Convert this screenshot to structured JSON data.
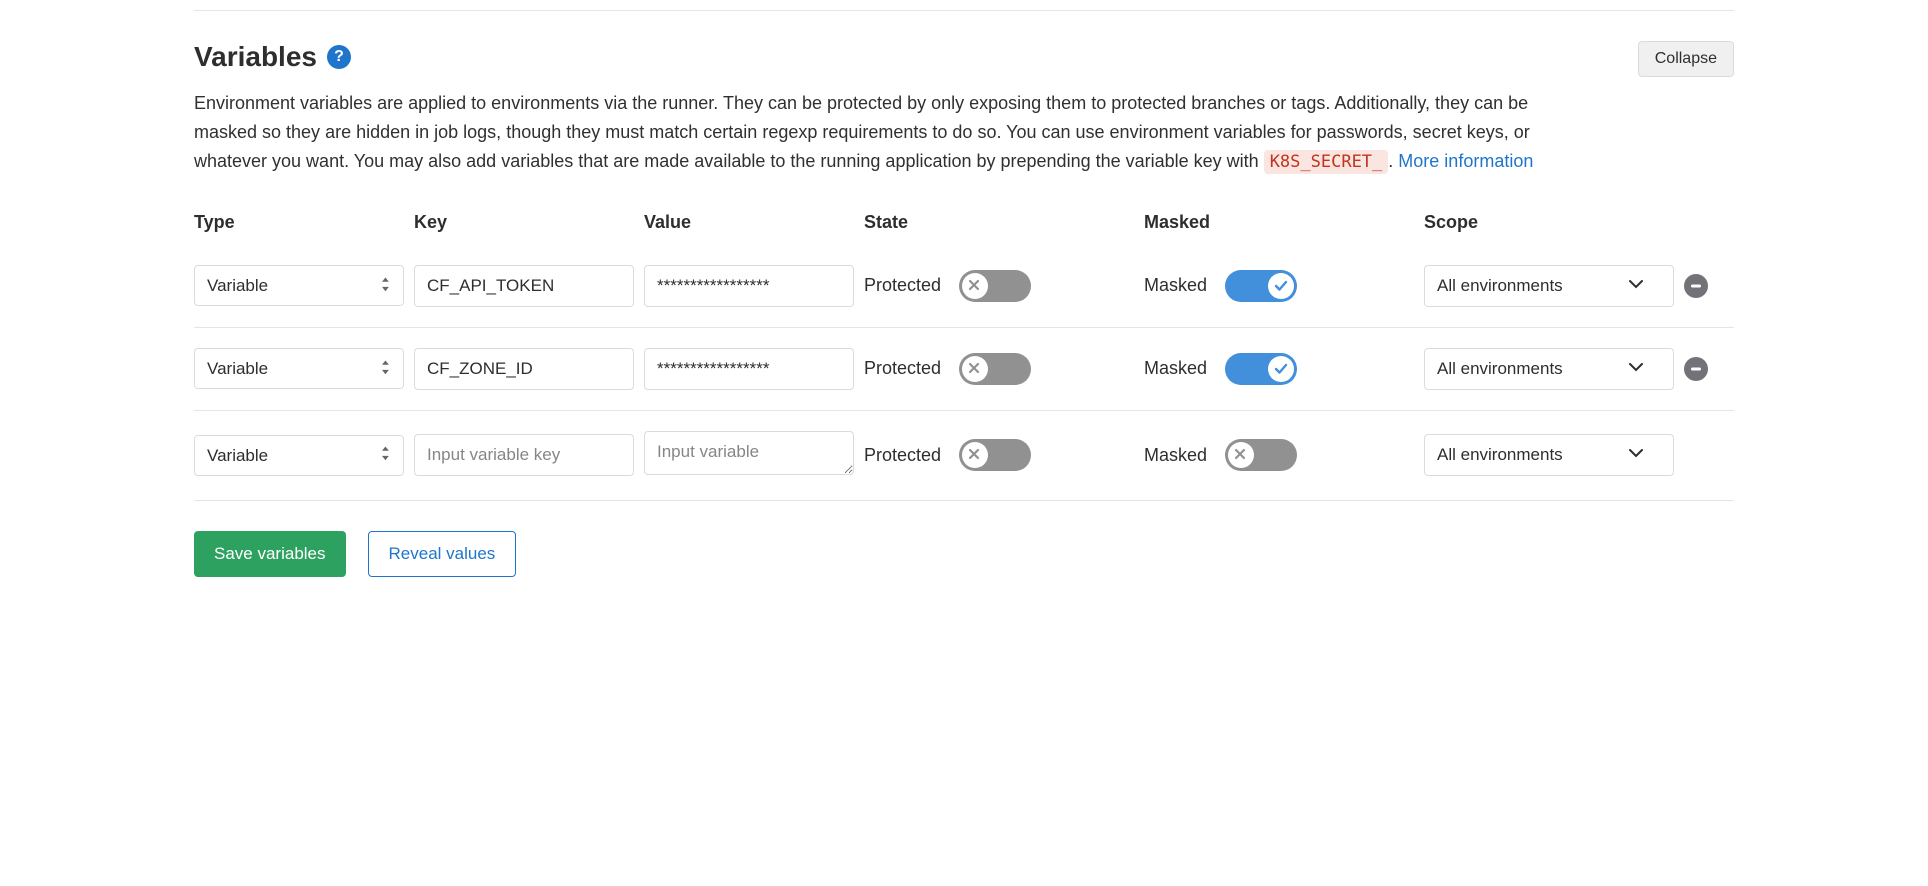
{
  "header": {
    "title": "Variables",
    "collapse_label": "Collapse"
  },
  "description": {
    "text_before_code": "Environment variables are applied to environments via the runner. They can be protected by only exposing them to protected branches or tags. Additionally, they can be masked so they are hidden in job logs, though they must match certain regexp requirements to do so. You can use environment variables for passwords, secret keys, or whatever you want. You may also add variables that are made available to the running application by prepending the variable key with ",
    "code_snippet": "K8S_SECRET_",
    "period": ". ",
    "link_text": "More information"
  },
  "columns": {
    "type": "Type",
    "key": "Key",
    "value": "Value",
    "state": "State",
    "masked": "Masked",
    "scope": "Scope"
  },
  "labels": {
    "protected": "Protected",
    "masked": "Masked"
  },
  "type_option": "Variable",
  "scope_option": "All environments",
  "placeholders": {
    "key": "Input variable key",
    "value": "Input variable"
  },
  "rows": [
    {
      "type": "Variable",
      "key": "CF_API_TOKEN",
      "value": "*****************",
      "protected": false,
      "masked": true,
      "scope": "All environments",
      "removable": true
    },
    {
      "type": "Variable",
      "key": "CF_ZONE_ID",
      "value": "*****************",
      "protected": false,
      "masked": true,
      "scope": "All environments",
      "removable": true
    },
    {
      "type": "Variable",
      "key": "",
      "value": "",
      "protected": false,
      "masked": false,
      "scope": "All environments",
      "removable": false
    }
  ],
  "actions": {
    "save": "Save variables",
    "reveal": "Reveal values"
  }
}
